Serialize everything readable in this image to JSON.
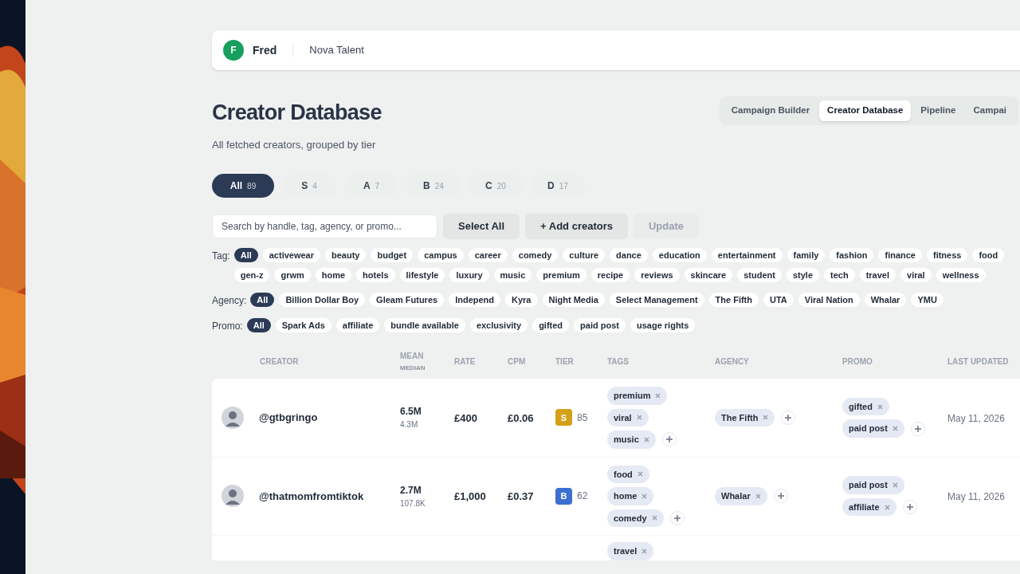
{
  "header": {
    "avatar_letter": "F",
    "user": "Fred",
    "workspace": "Nova Talent"
  },
  "title": "Creator Database",
  "subtitle": "All fetched creators, grouped by tier",
  "nav_tabs": [
    {
      "label": "Campaign Builder",
      "selected": false
    },
    {
      "label": "Creator Database",
      "selected": true
    },
    {
      "label": "Pipeline",
      "selected": false
    },
    {
      "label": "Campai",
      "selected": false
    }
  ],
  "tier_filters": [
    {
      "label": "All",
      "count": "89",
      "selected": true
    },
    {
      "label": "S",
      "count": "4",
      "selected": false
    },
    {
      "label": "A",
      "count": "7",
      "selected": false
    },
    {
      "label": "B",
      "count": "24",
      "selected": false
    },
    {
      "label": "C",
      "count": "20",
      "selected": false
    },
    {
      "label": "D",
      "count": "17",
      "selected": false
    }
  ],
  "search": {
    "placeholder": "Search by handle, tag, agency, or promo..."
  },
  "buttons": [
    {
      "label": "Select All",
      "disabled": false
    },
    {
      "label": "+ Add creators",
      "disabled": false
    },
    {
      "label": "Update",
      "disabled": true
    }
  ],
  "filters": [
    {
      "label": "Tag:",
      "chips": [
        {
          "label": "All",
          "selected": true
        },
        {
          "label": "activewear",
          "selected": false
        },
        {
          "label": "beauty",
          "selected": false
        },
        {
          "label": "budget",
          "selected": false
        },
        {
          "label": "campus",
          "selected": false
        },
        {
          "label": "career",
          "selected": false
        },
        {
          "label": "comedy",
          "selected": false
        },
        {
          "label": "culture",
          "selected": false
        },
        {
          "label": "dance",
          "selected": false
        },
        {
          "label": "education",
          "selected": false
        },
        {
          "label": "entertainment",
          "selected": false
        },
        {
          "label": "family",
          "selected": false
        },
        {
          "label": "fashion",
          "selected": false
        },
        {
          "label": "finance",
          "selected": false
        },
        {
          "label": "fitness",
          "selected": false
        },
        {
          "label": "food",
          "selected": false
        },
        {
          "label": "gen-z",
          "selected": false
        },
        {
          "label": "grwm",
          "selected": false
        },
        {
          "label": "home",
          "selected": false
        },
        {
          "label": "hotels",
          "selected": false
        },
        {
          "label": "lifestyle",
          "selected": false
        },
        {
          "label": "luxury",
          "selected": false
        },
        {
          "label": "music",
          "selected": false
        },
        {
          "label": "premium",
          "selected": false
        },
        {
          "label": "recipe",
          "selected": false
        },
        {
          "label": "reviews",
          "selected": false
        },
        {
          "label": "skincare",
          "selected": false
        },
        {
          "label": "student",
          "selected": false
        },
        {
          "label": "style",
          "selected": false
        },
        {
          "label": "tech",
          "selected": false
        },
        {
          "label": "travel",
          "selected": false
        },
        {
          "label": "viral",
          "selected": false
        },
        {
          "label": "wellness",
          "selected": false
        }
      ]
    },
    {
      "label": "Agency:",
      "chips": [
        {
          "label": "All",
          "selected": true
        },
        {
          "label": "Billion Dollar Boy",
          "selected": false
        },
        {
          "label": "Gleam Futures",
          "selected": false
        },
        {
          "label": "Independ",
          "selected": false
        },
        {
          "label": "Kyra",
          "selected": false
        },
        {
          "label": "Night Media",
          "selected": false
        },
        {
          "label": "Select Management",
          "selected": false
        },
        {
          "label": "The Fifth",
          "selected": false
        },
        {
          "label": "UTA",
          "selected": false
        },
        {
          "label": "Viral Nation",
          "selected": false
        },
        {
          "label": "Whalar",
          "selected": false
        },
        {
          "label": "YMU",
          "selected": false
        }
      ]
    },
    {
      "label": "Promo:",
      "chips": [
        {
          "label": "All",
          "selected": true
        },
        {
          "label": "Spark Ads",
          "selected": false
        },
        {
          "label": "affiliate",
          "selected": false
        },
        {
          "label": "bundle available",
          "selected": false
        },
        {
          "label": "exclusivity",
          "selected": false
        },
        {
          "label": "gifted",
          "selected": false
        },
        {
          "label": "paid post",
          "selected": false
        },
        {
          "label": "usage rights",
          "selected": false
        }
      ]
    }
  ],
  "table": {
    "columns": [
      {
        "label": "CREATOR"
      },
      {
        "label": "MEAN",
        "sublabel": "MEDIAN"
      },
      {
        "label": "RATE"
      },
      {
        "label": "CPM"
      },
      {
        "label": "TIER"
      },
      {
        "label": "TAGS"
      },
      {
        "label": "AGENCY"
      },
      {
        "label": "PROMO"
      },
      {
        "label": "LAST UPDATED"
      }
    ],
    "rows": [
      {
        "handle": "@gtbgringo",
        "mean": "6.5M",
        "median": "4.3M",
        "rate": "£400",
        "cpm": "£0.06",
        "tier": {
          "letter": "S",
          "score": "85",
          "color": "#d4a017"
        },
        "tags": [
          "premium",
          "viral",
          "music"
        ],
        "agency": [
          "The Fifth"
        ],
        "promo": [
          "gifted",
          "paid post"
        ],
        "updated": "May 11, 2026"
      },
      {
        "handle": "@thatmomfromtiktok",
        "mean": "2.7M",
        "median": "107.8K",
        "rate": "£1,000",
        "cpm": "£0.37",
        "tier": {
          "letter": "B",
          "score": "62",
          "color": "#3b6fd1"
        },
        "tags": [
          "food",
          "home",
          "comedy"
        ],
        "agency": [
          "Whalar"
        ],
        "promo": [
          "paid post",
          "affiliate"
        ],
        "updated": "May 11, 2026"
      },
      {
        "tags": [
          "travel"
        ]
      }
    ]
  }
}
